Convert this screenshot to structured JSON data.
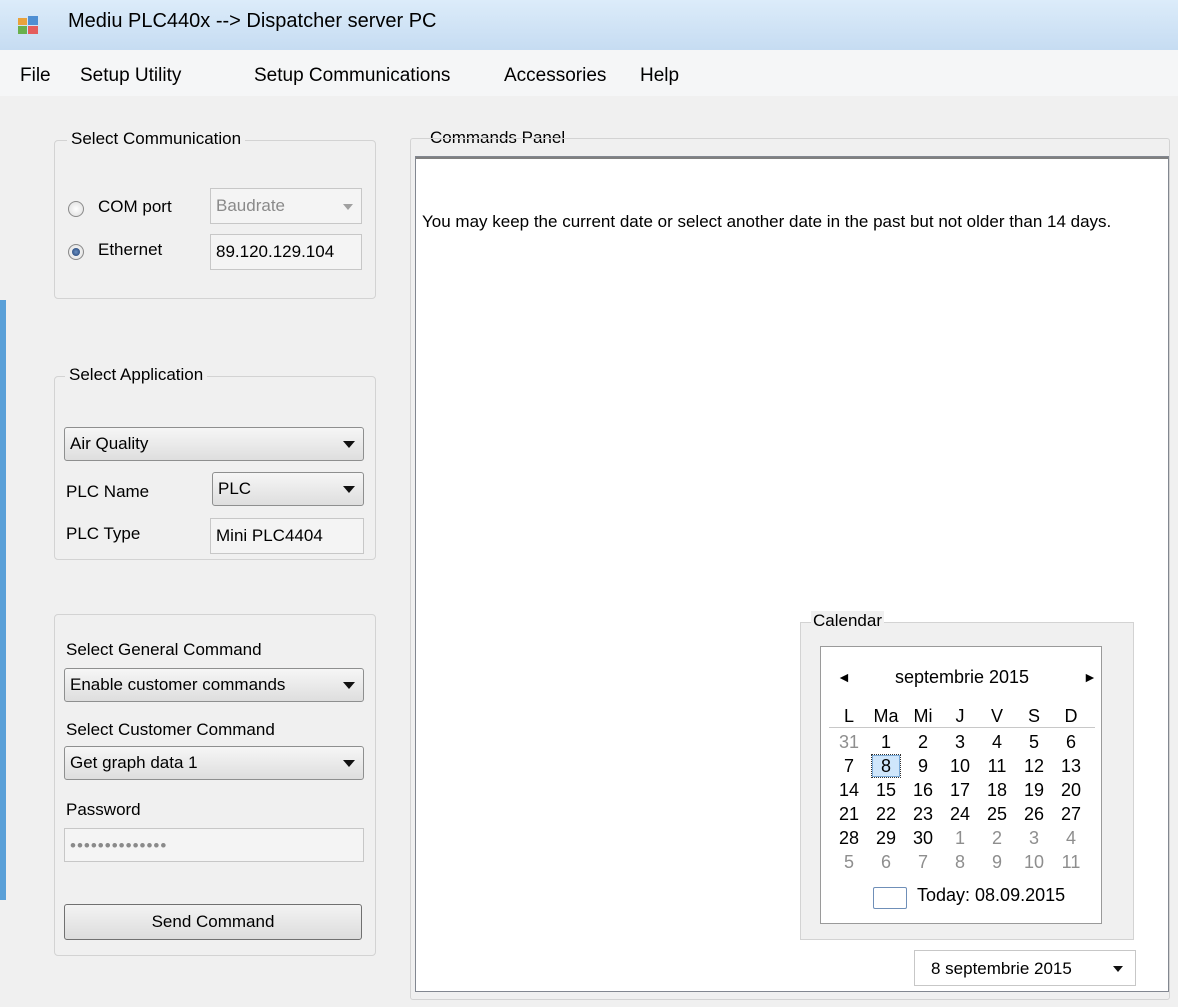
{
  "window": {
    "title": "Mediu PLC440x --> Dispatcher server PC"
  },
  "menu": {
    "file": "File",
    "setup_utility": "Setup Utility",
    "setup_communications": "Setup Communications",
    "accessories": "Accessories",
    "help": "Help"
  },
  "communication": {
    "caption": "Select Communication",
    "com_port_label": "COM port",
    "baudrate": "Baudrate",
    "ethernet_label": "Ethernet",
    "ip_address": "89.120.129.104",
    "selected": "ethernet"
  },
  "application": {
    "caption": "Select Application",
    "selected_app": "Air Quality",
    "plc_name_label": "PLC Name",
    "plc_name_value": "PLC",
    "plc_type_label": "PLC Type",
    "plc_type_value": "Mini PLC4404"
  },
  "commands": {
    "general_label": "Select General Command",
    "general_value": "Enable customer commands",
    "customer_label": "Select Customer Command",
    "customer_value": "Get graph data 1",
    "password_label": "Password",
    "password_value": "••••••••••••••",
    "send_button": "Send Command"
  },
  "commands_panel": {
    "caption": "Commands Panel",
    "message": "You may keep the current date or select another date in the past but not older than 14 days."
  },
  "calendar": {
    "caption": "Calendar",
    "month_year": "septembrie 2015",
    "prev": "◄",
    "next": "►",
    "weekdays": [
      "L",
      "Ma",
      "Mi",
      "J",
      "V",
      "S",
      "D"
    ],
    "weeks": [
      [
        {
          "d": "31",
          "dim": true
        },
        {
          "d": "1"
        },
        {
          "d": "2"
        },
        {
          "d": "3"
        },
        {
          "d": "4"
        },
        {
          "d": "5"
        },
        {
          "d": "6"
        }
      ],
      [
        {
          "d": "7"
        },
        {
          "d": "8",
          "sel": true
        },
        {
          "d": "9"
        },
        {
          "d": "10"
        },
        {
          "d": "11"
        },
        {
          "d": "12"
        },
        {
          "d": "13"
        }
      ],
      [
        {
          "d": "14"
        },
        {
          "d": "15"
        },
        {
          "d": "16"
        },
        {
          "d": "17"
        },
        {
          "d": "18"
        },
        {
          "d": "19"
        },
        {
          "d": "20"
        }
      ],
      [
        {
          "d": "21"
        },
        {
          "d": "22"
        },
        {
          "d": "23"
        },
        {
          "d": "24"
        },
        {
          "d": "25"
        },
        {
          "d": "26"
        },
        {
          "d": "27"
        }
      ],
      [
        {
          "d": "28"
        },
        {
          "d": "29"
        },
        {
          "d": "30"
        },
        {
          "d": "1",
          "dim": true
        },
        {
          "d": "2",
          "dim": true
        },
        {
          "d": "3",
          "dim": true
        },
        {
          "d": "4",
          "dim": true
        }
      ],
      [
        {
          "d": "5",
          "dim": true
        },
        {
          "d": "6",
          "dim": true
        },
        {
          "d": "7",
          "dim": true
        },
        {
          "d": "8",
          "dim": true
        },
        {
          "d": "9",
          "dim": true
        },
        {
          "d": "10",
          "dim": true
        },
        {
          "d": "11",
          "dim": true
        }
      ]
    ],
    "today": "Today: 08.09.2015",
    "picker_value": "8 septembrie 2015"
  }
}
